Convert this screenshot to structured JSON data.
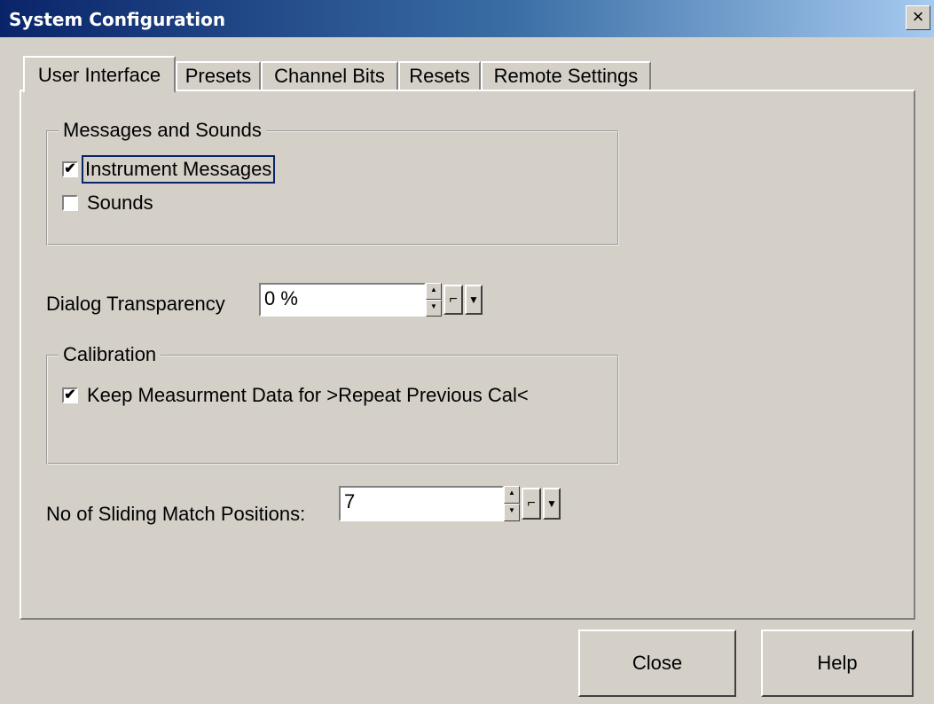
{
  "window": {
    "title": "System Configuration",
    "close_glyph": "×"
  },
  "tabs": [
    {
      "label": "User Interface",
      "active": true
    },
    {
      "label": "Presets"
    },
    {
      "label": "Channel Bits"
    },
    {
      "label": "Resets"
    },
    {
      "label": "Remote Settings"
    }
  ],
  "messages_group": {
    "title": "Messages and Sounds",
    "items": [
      {
        "label": "Instrument Messages",
        "checked": true,
        "check_glyph": "✔"
      },
      {
        "label": "Sounds",
        "checked": false,
        "check_glyph": ""
      }
    ]
  },
  "transparency": {
    "label": "Dialog  Transparency",
    "value": "0 %"
  },
  "calibration_group": {
    "title": "Calibration",
    "items": [
      {
        "label": "Keep Measurment Data for >Repeat Previous Cal<",
        "checked": true,
        "check_glyph": "✔"
      }
    ]
  },
  "sliding": {
    "label": "No of Sliding Match Positions:",
    "value": "7"
  },
  "spinner_icons": {
    "up": "▲",
    "down": "▼",
    "step": "⌐",
    "dropdown": "▼"
  },
  "buttons": {
    "close": "Close",
    "help": "Help"
  }
}
